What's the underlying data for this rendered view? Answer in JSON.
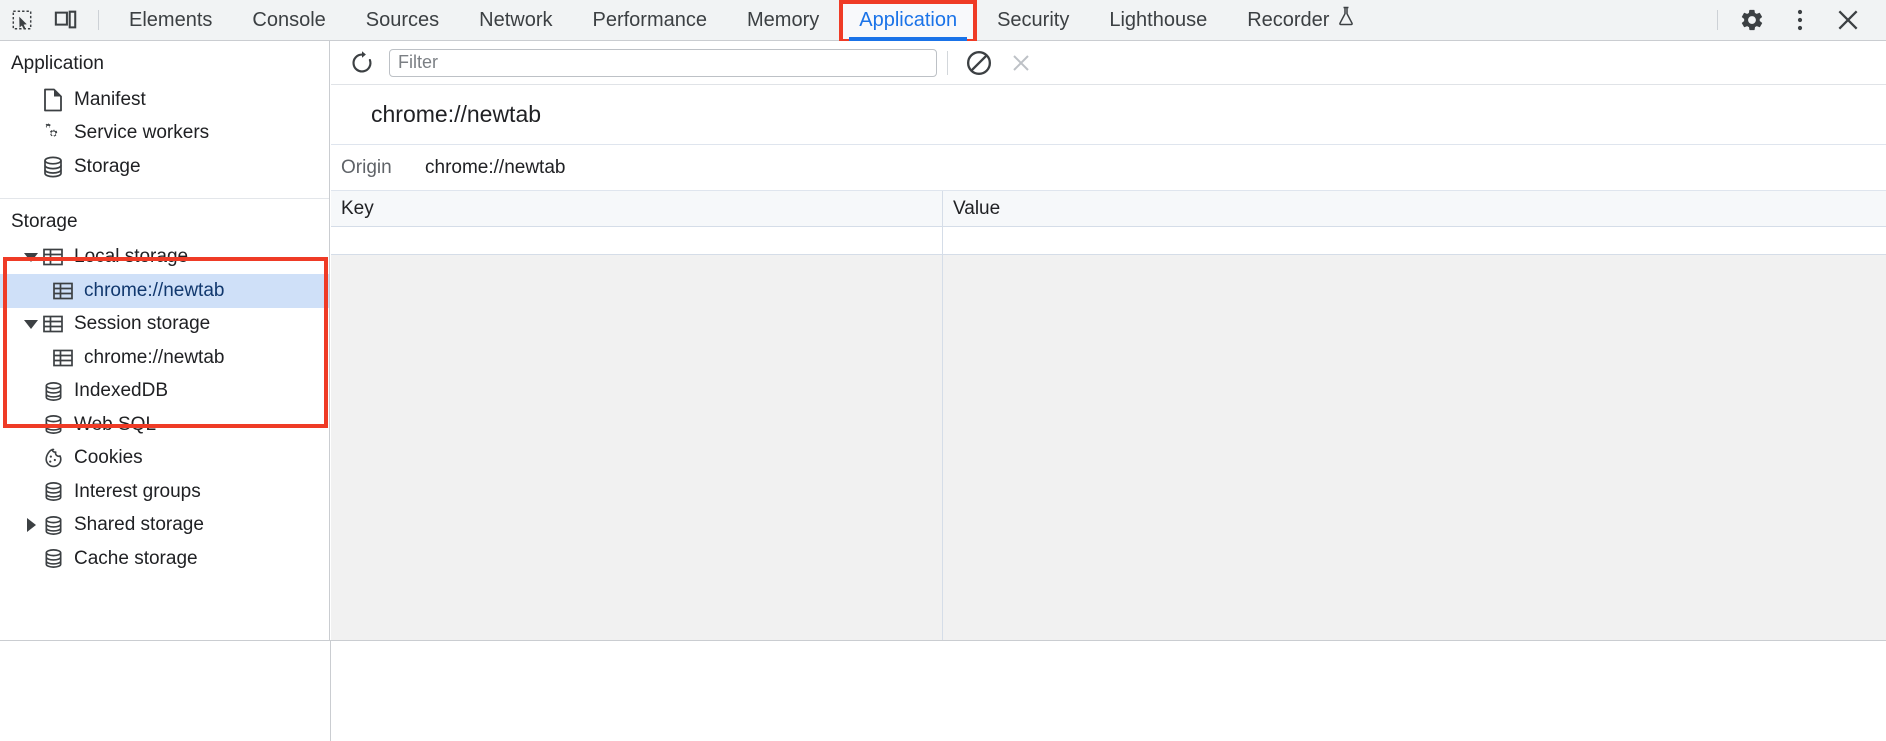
{
  "tabbar": {
    "left_icons": [
      {
        "name": "inspect-element-icon",
        "glyph": "inspect"
      },
      {
        "name": "device-toolbar-icon",
        "glyph": "device"
      }
    ],
    "tabs": [
      {
        "label": "Elements",
        "active": false
      },
      {
        "label": "Console",
        "active": false
      },
      {
        "label": "Sources",
        "active": false
      },
      {
        "label": "Network",
        "active": false
      },
      {
        "label": "Performance",
        "active": false
      },
      {
        "label": "Memory",
        "active": false
      },
      {
        "label": "Application",
        "active": true
      },
      {
        "label": "Security",
        "active": false
      },
      {
        "label": "Lighthouse",
        "active": false
      },
      {
        "label": "Recorder",
        "active": false,
        "badge_icon": "flask-icon"
      }
    ],
    "right_icons": [
      {
        "name": "settings-gear-icon"
      },
      {
        "name": "more-options-kebab-icon"
      },
      {
        "name": "close-devtools-icon"
      }
    ],
    "active_tab_color": "#1a73e8",
    "annotation_color": "#ef3b26"
  },
  "sidebar": {
    "application_section": {
      "title": "Application",
      "items": [
        {
          "label": "Manifest",
          "icon": "manifest-document-icon",
          "twisty": "none",
          "indent": 1,
          "selected": false
        },
        {
          "label": "Service workers",
          "icon": "service-workers-gears-icon",
          "twisty": "none",
          "indent": 1,
          "selected": false
        },
        {
          "label": "Storage",
          "icon": "storage-database-icon",
          "twisty": "none",
          "indent": 1,
          "selected": false
        }
      ]
    },
    "storage_section": {
      "title": "Storage",
      "items": [
        {
          "label": "Local storage",
          "icon": "table-grid-icon",
          "twisty": "open",
          "indent": 1,
          "selected": false
        },
        {
          "label": "chrome://newtab",
          "icon": "table-grid-icon",
          "twisty": "none",
          "indent": 2,
          "selected": true
        },
        {
          "label": "Session storage",
          "icon": "table-grid-icon",
          "twisty": "open",
          "indent": 1,
          "selected": false
        },
        {
          "label": "chrome://newtab",
          "icon": "table-grid-icon",
          "twisty": "none",
          "indent": 2,
          "selected": false
        },
        {
          "label": "IndexedDB",
          "icon": "database-icon",
          "twisty": "none",
          "indent": 1,
          "selected": false
        },
        {
          "label": "Web SQL",
          "icon": "database-icon",
          "twisty": "none",
          "indent": 1,
          "selected": false
        },
        {
          "label": "Cookies",
          "icon": "cookie-icon",
          "twisty": "none",
          "indent": 1,
          "selected": false
        },
        {
          "label": "Interest groups",
          "icon": "database-icon",
          "twisty": "none",
          "indent": 1,
          "selected": false
        },
        {
          "label": "Shared storage",
          "icon": "database-icon",
          "twisty": "closed",
          "indent": 1,
          "selected": false
        },
        {
          "label": "Cache storage",
          "icon": "database-icon",
          "twisty": "none",
          "indent": 1,
          "selected": false
        }
      ]
    }
  },
  "main": {
    "toolbar": {
      "refresh_icon": "refresh-icon",
      "filter_placeholder": "Filter",
      "filter_value": "",
      "clear_icon": "clear-all-icon",
      "delete_icon": "delete-selected-icon"
    },
    "panel_title": "chrome://newtab",
    "origin": {
      "label": "Origin",
      "value": "chrome://newtab"
    },
    "table": {
      "columns": [
        "Key",
        "Value"
      ],
      "rows": [
        {
          "key": "",
          "value": ""
        }
      ]
    }
  }
}
